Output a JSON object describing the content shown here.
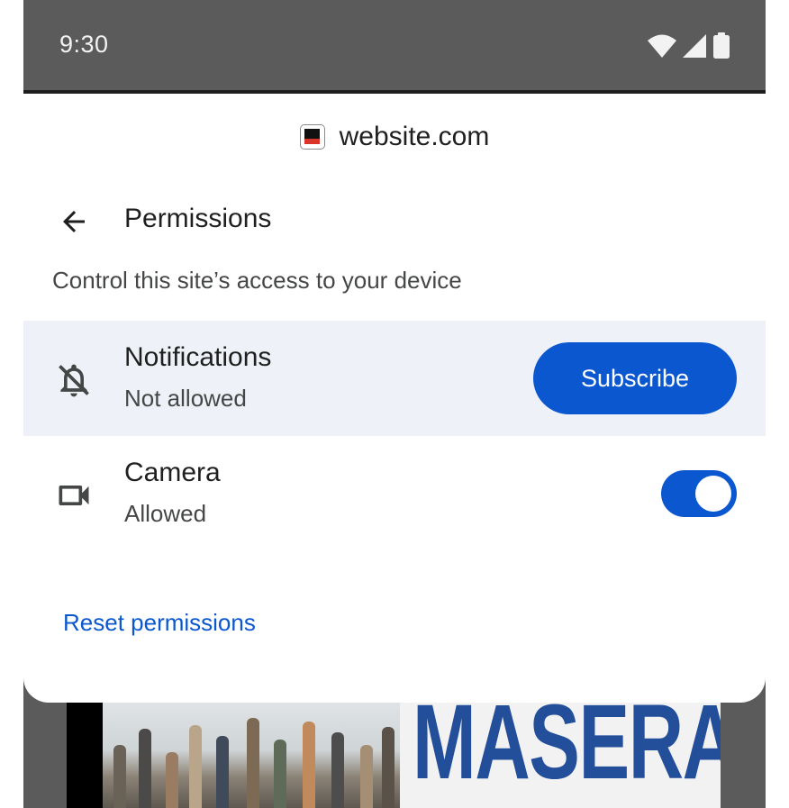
{
  "status_bar": {
    "time": "9:30",
    "icons": [
      "wifi-icon",
      "cellular-signal-icon",
      "battery-icon"
    ]
  },
  "sheet": {
    "site": {
      "favicon": "site-favicon",
      "name": "website.com"
    },
    "header": {
      "back_icon": "arrow-back-icon",
      "title": "Permissions"
    },
    "subtitle": "Control this site’s access to your device",
    "permissions": [
      {
        "icon": "notifications-off-icon",
        "name": "Notifications",
        "status": "Not allowed",
        "action_label": "Subscribe"
      },
      {
        "icon": "videocam-icon",
        "name": "Camera",
        "status": "Allowed",
        "toggle_on": true
      }
    ],
    "reset_label": "Reset permissions"
  },
  "background": {
    "brand_text": "MASERATI"
  },
  "colors": {
    "accent": "#0b57d0",
    "highlight_row": "#eef1f7",
    "status_bar": "#5b5b5b",
    "text_primary": "#1f1f1f",
    "text_secondary": "#444746"
  }
}
